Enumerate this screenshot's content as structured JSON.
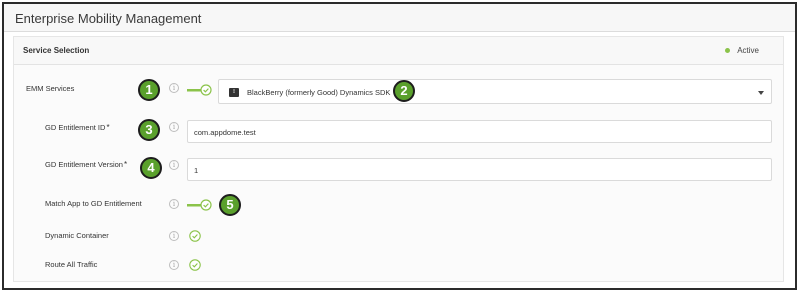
{
  "page": {
    "title": "Enterprise Mobility Management"
  },
  "card": {
    "title": "Service Selection",
    "status": "Active"
  },
  "rows": {
    "emm": {
      "label": "EMM Services",
      "badge": "1",
      "select_value": "BlackBerry (formerly Good) Dynamics SDK",
      "select_badge": "2",
      "icon": "blackberry-logo"
    },
    "entitlement_id": {
      "label": "GD Entitlement ID",
      "required_mark": "*",
      "badge": "3",
      "value": "com.appdome.test"
    },
    "entitlement_version": {
      "label": "GD Entitlement Version",
      "required_mark": "*",
      "badge": "4",
      "value": "1"
    },
    "match_app": {
      "label": "Match App to GD Entitlement",
      "badge": "5"
    },
    "dynamic_container": {
      "label": "Dynamic Container"
    },
    "route_all": {
      "label": "Route All Traffic"
    }
  },
  "colors": {
    "accent": "#8bc34a",
    "badge": "#5aa02c",
    "frame_border": "#2b2b2b"
  }
}
